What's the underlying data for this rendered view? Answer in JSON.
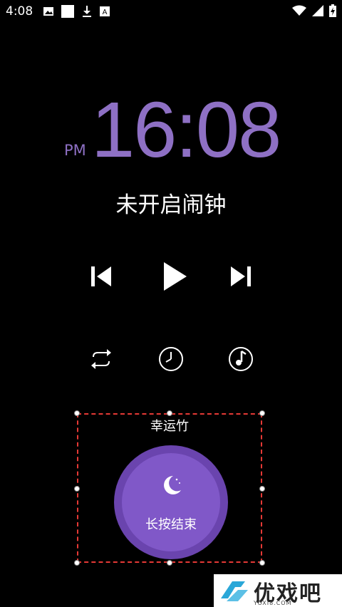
{
  "status_bar": {
    "time": "4:08",
    "left_icons": [
      "image-icon",
      "square-icon",
      "download-icon",
      "a-box-icon"
    ],
    "right_icons": [
      "wifi-icon",
      "signal-icon",
      "battery-charging-icon"
    ]
  },
  "clock": {
    "ampm": "PM",
    "time": "16:08",
    "color": "#8e70c4"
  },
  "alarm": {
    "status": "未开启闹钟"
  },
  "player": {
    "controls": [
      "previous-icon",
      "play-icon",
      "next-icon"
    ],
    "modes": [
      "repeat-icon",
      "timer-icon",
      "music-disc-icon"
    ]
  },
  "sleep": {
    "song_title": "幸运竹",
    "end_label": "长按结束",
    "accent": "#8058c8"
  },
  "watermark": {
    "text": "优戏吧",
    "sub": "YOXI8.COM"
  }
}
